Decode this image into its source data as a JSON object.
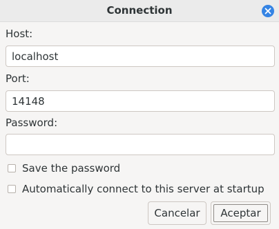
{
  "window": {
    "title": "Connection",
    "close_icon": "close-icon"
  },
  "form": {
    "host_label": "Host:",
    "host_value": "localhost",
    "port_label": "Port:",
    "port_value": "14148",
    "password_label": "Password:",
    "password_value": ""
  },
  "options": {
    "save_password_label": "Save the password",
    "save_password_checked": false,
    "auto_connect_label": "Automatically connect to this server at startup",
    "auto_connect_checked": false
  },
  "buttons": {
    "cancel_label": "Cancelar",
    "accept_label": "Aceptar"
  },
  "colors": {
    "accent": "#3584e4",
    "background": "#f6f5f4",
    "titlebar": "#ebebeb"
  }
}
